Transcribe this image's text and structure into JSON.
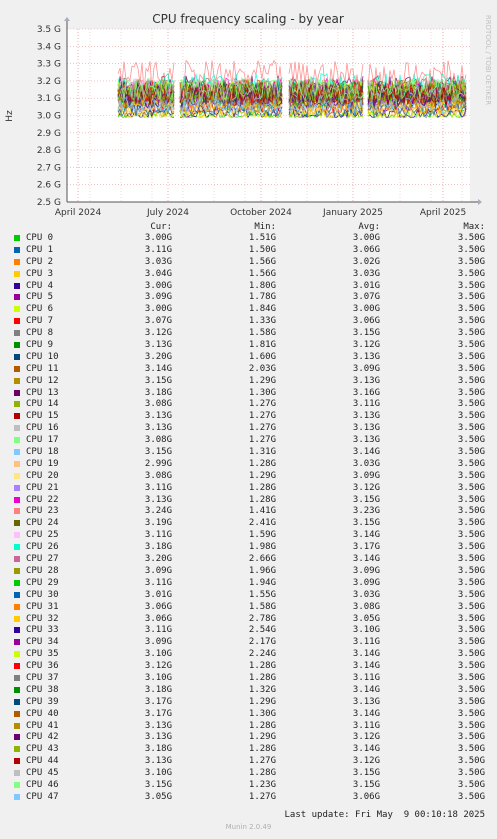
{
  "chart_data": {
    "type": "line",
    "title": "CPU frequency scaling - by year",
    "ylabel": "Hz",
    "y_ticks": [
      "2.5 G",
      "2.6 G",
      "2.7 G",
      "2.8 G",
      "2.9 G",
      "3.0 G",
      "3.1 G",
      "3.2 G",
      "3.3 G",
      "3.4 G",
      "3.5 G"
    ],
    "x_ticks": [
      "April 2024",
      "July 2024",
      "October 2024",
      "January 2025",
      "April 2025"
    ],
    "ylim": [
      2.5,
      3.5
    ],
    "side_label": "RRDTOOL / TOBI OETIKER",
    "grid": true,
    "legend_headers": {
      "cur": "Cur:",
      "min": "Min:",
      "avg": "Avg:",
      "max": "Max:"
    },
    "series": [
      {
        "name": "CPU 0",
        "color": "#00cc00",
        "cur": "3.00G",
        "min": "1.51G",
        "avg": "3.00G",
        "max": "3.50G"
      },
      {
        "name": "CPU 1",
        "color": "#0066b3",
        "cur": "3.11G",
        "min": "1.50G",
        "avg": "3.06G",
        "max": "3.50G"
      },
      {
        "name": "CPU 2",
        "color": "#ff8000",
        "cur": "3.03G",
        "min": "1.56G",
        "avg": "3.02G",
        "max": "3.50G"
      },
      {
        "name": "CPU 3",
        "color": "#ffcc00",
        "cur": "3.04G",
        "min": "1.56G",
        "avg": "3.03G",
        "max": "3.50G"
      },
      {
        "name": "CPU 4",
        "color": "#330099",
        "cur": "3.00G",
        "min": "1.80G",
        "avg": "3.01G",
        "max": "3.50G"
      },
      {
        "name": "CPU 5",
        "color": "#990099",
        "cur": "3.09G",
        "min": "1.78G",
        "avg": "3.07G",
        "max": "3.50G"
      },
      {
        "name": "CPU 6",
        "color": "#ccff00",
        "cur": "3.00G",
        "min": "1.84G",
        "avg": "3.00G",
        "max": "3.50G"
      },
      {
        "name": "CPU 7",
        "color": "#ff0000",
        "cur": "3.07G",
        "min": "1.33G",
        "avg": "3.06G",
        "max": "3.50G"
      },
      {
        "name": "CPU 8",
        "color": "#808080",
        "cur": "3.12G",
        "min": "1.58G",
        "avg": "3.15G",
        "max": "3.50G"
      },
      {
        "name": "CPU 9",
        "color": "#008f00",
        "cur": "3.13G",
        "min": "1.81G",
        "avg": "3.12G",
        "max": "3.50G"
      },
      {
        "name": "CPU 10",
        "color": "#00487d",
        "cur": "3.20G",
        "min": "1.60G",
        "avg": "3.13G",
        "max": "3.50G"
      },
      {
        "name": "CPU 11",
        "color": "#b35a00",
        "cur": "3.14G",
        "min": "2.03G",
        "avg": "3.09G",
        "max": "3.50G"
      },
      {
        "name": "CPU 12",
        "color": "#b38f00",
        "cur": "3.15G",
        "min": "1.29G",
        "avg": "3.13G",
        "max": "3.50G"
      },
      {
        "name": "CPU 13",
        "color": "#6b006b",
        "cur": "3.18G",
        "min": "1.30G",
        "avg": "3.16G",
        "max": "3.50G"
      },
      {
        "name": "CPU 14",
        "color": "#8fb300",
        "cur": "3.08G",
        "min": "1.27G",
        "avg": "3.11G",
        "max": "3.50G"
      },
      {
        "name": "CPU 15",
        "color": "#b30000",
        "cur": "3.13G",
        "min": "1.27G",
        "avg": "3.13G",
        "max": "3.50G"
      },
      {
        "name": "CPU 16",
        "color": "#bebebe",
        "cur": "3.13G",
        "min": "1.27G",
        "avg": "3.13G",
        "max": "3.50G"
      },
      {
        "name": "CPU 17",
        "color": "#80ff80",
        "cur": "3.08G",
        "min": "1.27G",
        "avg": "3.13G",
        "max": "3.50G"
      },
      {
        "name": "CPU 18",
        "color": "#80c9ff",
        "cur": "3.15G",
        "min": "1.31G",
        "avg": "3.14G",
        "max": "3.50G"
      },
      {
        "name": "CPU 19",
        "color": "#ffc080",
        "cur": "2.99G",
        "min": "1.28G",
        "avg": "3.03G",
        "max": "3.50G"
      },
      {
        "name": "CPU 20",
        "color": "#ffe680",
        "cur": "3.08G",
        "min": "1.29G",
        "avg": "3.09G",
        "max": "3.50G"
      },
      {
        "name": "CPU 21",
        "color": "#aa80ff",
        "cur": "3.11G",
        "min": "1.28G",
        "avg": "3.12G",
        "max": "3.50G"
      },
      {
        "name": "CPU 22",
        "color": "#ee00cc",
        "cur": "3.13G",
        "min": "1.28G",
        "avg": "3.15G",
        "max": "3.50G"
      },
      {
        "name": "CPU 23",
        "color": "#ff8080",
        "cur": "3.24G",
        "min": "1.41G",
        "avg": "3.23G",
        "max": "3.50G"
      },
      {
        "name": "CPU 24",
        "color": "#666600",
        "cur": "3.19G",
        "min": "2.41G",
        "avg": "3.15G",
        "max": "3.50G"
      },
      {
        "name": "CPU 25",
        "color": "#ffbfff",
        "cur": "3.11G",
        "min": "1.59G",
        "avg": "3.14G",
        "max": "3.50G"
      },
      {
        "name": "CPU 26",
        "color": "#00ffcc",
        "cur": "3.18G",
        "min": "1.98G",
        "avg": "3.17G",
        "max": "3.50G"
      },
      {
        "name": "CPU 27",
        "color": "#cc6699",
        "cur": "3.20G",
        "min": "2.66G",
        "avg": "3.14G",
        "max": "3.50G"
      },
      {
        "name": "CPU 28",
        "color": "#999900",
        "cur": "3.09G",
        "min": "1.96G",
        "avg": "3.09G",
        "max": "3.50G"
      },
      {
        "name": "CPU 29",
        "color": "#00cc00",
        "cur": "3.11G",
        "min": "1.94G",
        "avg": "3.09G",
        "max": "3.50G"
      },
      {
        "name": "CPU 30",
        "color": "#0066b3",
        "cur": "3.01G",
        "min": "1.55G",
        "avg": "3.03G",
        "max": "3.50G"
      },
      {
        "name": "CPU 31",
        "color": "#ff8000",
        "cur": "3.06G",
        "min": "1.58G",
        "avg": "3.08G",
        "max": "3.50G"
      },
      {
        "name": "CPU 32",
        "color": "#ffcc00",
        "cur": "3.06G",
        "min": "2.78G",
        "avg": "3.05G",
        "max": "3.50G"
      },
      {
        "name": "CPU 33",
        "color": "#330099",
        "cur": "3.11G",
        "min": "2.54G",
        "avg": "3.10G",
        "max": "3.50G"
      },
      {
        "name": "CPU 34",
        "color": "#990099",
        "cur": "3.09G",
        "min": "2.17G",
        "avg": "3.11G",
        "max": "3.50G"
      },
      {
        "name": "CPU 35",
        "color": "#ccff00",
        "cur": "3.10G",
        "min": "2.24G",
        "avg": "3.14G",
        "max": "3.50G"
      },
      {
        "name": "CPU 36",
        "color": "#ff0000",
        "cur": "3.12G",
        "min": "1.28G",
        "avg": "3.14G",
        "max": "3.50G"
      },
      {
        "name": "CPU 37",
        "color": "#808080",
        "cur": "3.10G",
        "min": "1.28G",
        "avg": "3.11G",
        "max": "3.50G"
      },
      {
        "name": "CPU 38",
        "color": "#008f00",
        "cur": "3.18G",
        "min": "1.32G",
        "avg": "3.14G",
        "max": "3.50G"
      },
      {
        "name": "CPU 39",
        "color": "#00487d",
        "cur": "3.17G",
        "min": "1.29G",
        "avg": "3.13G",
        "max": "3.50G"
      },
      {
        "name": "CPU 40",
        "color": "#b35a00",
        "cur": "3.17G",
        "min": "1.30G",
        "avg": "3.14G",
        "max": "3.50G"
      },
      {
        "name": "CPU 41",
        "color": "#b38f00",
        "cur": "3.13G",
        "min": "1.28G",
        "avg": "3.11G",
        "max": "3.50G"
      },
      {
        "name": "CPU 42",
        "color": "#6b006b",
        "cur": "3.13G",
        "min": "1.29G",
        "avg": "3.12G",
        "max": "3.50G"
      },
      {
        "name": "CPU 43",
        "color": "#8fb300",
        "cur": "3.18G",
        "min": "1.28G",
        "avg": "3.14G",
        "max": "3.50G"
      },
      {
        "name": "CPU 44",
        "color": "#b30000",
        "cur": "3.13G",
        "min": "1.27G",
        "avg": "3.12G",
        "max": "3.50G"
      },
      {
        "name": "CPU 45",
        "color": "#bebebe",
        "cur": "3.10G",
        "min": "1.28G",
        "avg": "3.15G",
        "max": "3.50G"
      },
      {
        "name": "CPU 46",
        "color": "#80ff80",
        "cur": "3.15G",
        "min": "1.23G",
        "avg": "3.15G",
        "max": "3.50G"
      },
      {
        "name": "CPU 47",
        "color": "#80c9ff",
        "cur": "3.05G",
        "min": "1.27G",
        "avg": "3.06G",
        "max": "3.50G"
      }
    ]
  },
  "footer": {
    "last_update": "Last update: Fri May  9 00:10:18 2025",
    "munin": "Munin 2.0.49"
  }
}
